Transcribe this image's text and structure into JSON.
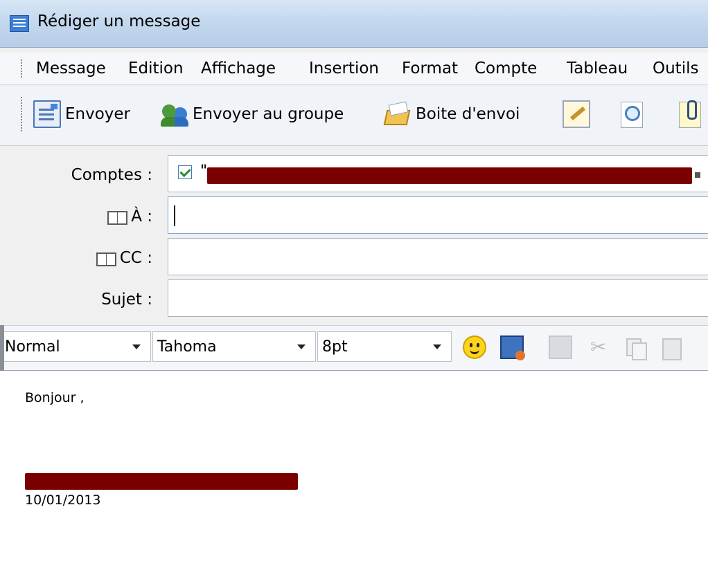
{
  "window": {
    "title": "Rédiger un message"
  },
  "menu": {
    "items": [
      "Message",
      "Edition",
      "Affichage",
      "Insertion",
      "Format",
      "Compte",
      "Tableau",
      "Outils"
    ]
  },
  "toolbar": {
    "send_label": "Envoyer",
    "send_group_label": "Envoyer au groupe",
    "outbox_label": "Boite d'envoi"
  },
  "fields": {
    "accounts_label": "Comptes :",
    "accounts_checked": true,
    "accounts_quote": "\"",
    "to_label": "À :",
    "to_value": "",
    "cc_label": "CC :",
    "cc_value": "",
    "subject_label": "Sujet :",
    "subject_value": ""
  },
  "format": {
    "style": "Normal",
    "font": "Tahoma",
    "size": "8pt"
  },
  "body": {
    "greeting": "Bonjour ,",
    "date": "10/01/2013"
  },
  "colors": {
    "redaction": "#7a0000",
    "titlebar": "#c4d8ee"
  },
  "icons": {
    "toolbar": [
      "send-icon",
      "group-icon",
      "outbox-icon",
      "edit-icon",
      "find-icon",
      "attach-icon"
    ],
    "format": [
      "smiley-icon",
      "screen-capture-icon",
      "box-icon",
      "cut-icon",
      "copy-icon",
      "paste-icon"
    ]
  }
}
